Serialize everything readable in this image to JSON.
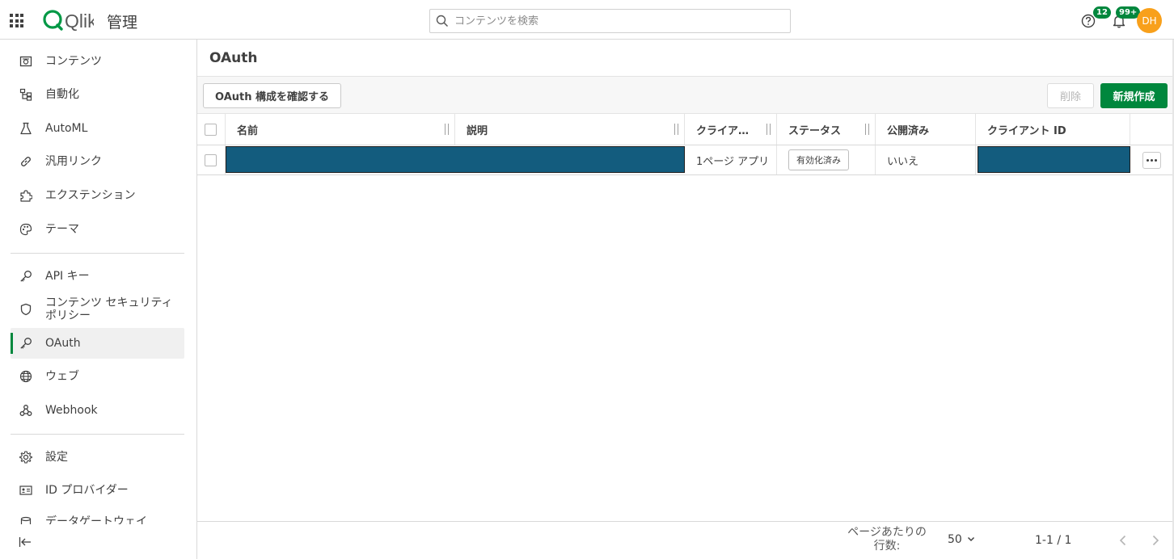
{
  "header": {
    "logo_text": "Qlik",
    "app_title": "管理",
    "search_placeholder": "コンテンツを検索",
    "help_badge": "12",
    "notifications_badge": "99+",
    "avatar_initials": "DH",
    "brand_color": "#00873d",
    "avatar_color": "#f8a01b"
  },
  "sidebar": {
    "items": [
      {
        "label": "コンテンツ",
        "icon": "content-icon"
      },
      {
        "label": "自動化",
        "icon": "automation-icon"
      },
      {
        "label": "AutoML",
        "icon": "flask-icon"
      },
      {
        "label": "汎用リンク",
        "icon": "link-icon"
      },
      {
        "label": "エクステンション",
        "icon": "puzzle-icon"
      },
      {
        "label": "テーマ",
        "icon": "palette-icon"
      },
      {
        "label": "API キー",
        "icon": "key-icon"
      },
      {
        "label": "コンテンツ セキュリティ ポリシー",
        "icon": "shield-icon"
      },
      {
        "label": "OAuth",
        "icon": "key-icon",
        "active": true
      },
      {
        "label": "ウェブ",
        "icon": "globe-icon"
      },
      {
        "label": "Webhook",
        "icon": "webhook-icon"
      },
      {
        "label": "設定",
        "icon": "gear-icon"
      },
      {
        "label": "ID プロバイダー",
        "icon": "id-card-icon"
      },
      {
        "label": "データゲートウェイ",
        "icon": "database-icon"
      }
    ],
    "collapse_icon": "collapse-left-icon"
  },
  "main": {
    "page_title": "OAuth",
    "toolbar": {
      "verify_label": "OAuth 構成を確認する",
      "delete_label": "削除",
      "create_label": "新規作成"
    },
    "table": {
      "columns": [
        "名前",
        "説明",
        "クライア…",
        "ステータス",
        "公開済み",
        "クライアント ID"
      ],
      "rows": [
        {
          "name": "",
          "description": "",
          "client_type": "1ページ アプリ",
          "status": "有効化済み",
          "published": "いいえ",
          "client_id": ""
        }
      ]
    },
    "footer": {
      "rows_per_page_label": "ページあたりの行数:",
      "rows_per_page_value": "50",
      "range": "1-1 / 1"
    }
  }
}
